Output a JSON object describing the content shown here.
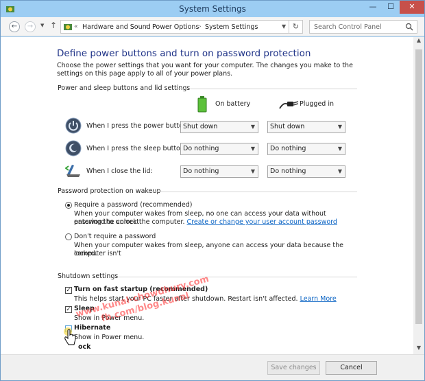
{
  "window": {
    "title": "System Settings",
    "controls": {
      "minimize": "—",
      "maximize": "☐",
      "close": "✕"
    }
  },
  "nav": {
    "back_icon": "arrow-left",
    "forward_icon": "arrow-right",
    "recent_icon": "chevron-down",
    "up_icon": "arrow-up",
    "overflow": "«",
    "breadcrumbs": [
      "Hardware and Sound",
      "Power Options",
      "System Settings"
    ],
    "separator": "›",
    "search_placeholder": "Search Control Panel"
  },
  "heading": "Define power buttons and turn on password protection",
  "intro": "Choose the power settings that you want for your computer. The changes you make to the settings on this page apply to all of your power plans.",
  "power_group": {
    "title": "Power and sleep buttons and lid settings",
    "col_battery": "On battery",
    "col_plugged": "Plugged in",
    "rows": [
      {
        "label": "When I press the power button:",
        "battery": "Shut down",
        "plugged": "Shut down",
        "icon": "power-button-icon"
      },
      {
        "label": "When I press the sleep button:",
        "battery": "Do nothing",
        "plugged": "Do nothing",
        "icon": "sleep-button-icon"
      },
      {
        "label": "When I close the lid:",
        "battery": "Do nothing",
        "plugged": "Do nothing",
        "icon": "laptop-lid-icon"
      }
    ]
  },
  "password_group": {
    "title": "Password protection on wakeup",
    "require_label": "Require a password (recommended)",
    "require_desc_1": "When your computer wakes from sleep, no one can access your data without entering the correct",
    "require_desc_2": "password to unlock the computer.",
    "require_link": "Create or change your user account password",
    "norequire_label": "Don't require a password",
    "norequire_desc_1": "When your computer wakes from sleep, anyone can access your data because the computer isn't",
    "norequire_desc_2": "locked.",
    "selected": "require"
  },
  "shutdown_group": {
    "title": "Shutdown settings",
    "fast_startup_label": "Turn on fast startup (recommended)",
    "fast_startup_desc": "This helps start your PC faster after shutdown. Restart isn't affected.",
    "learn_more": "Learn More",
    "sleep_label": "Sleep",
    "sleep_desc": "Show in Power menu.",
    "hibernate_label": "Hibernate",
    "hibernate_desc": "Show in Power menu.",
    "lock_label": "ock",
    "fast_startup_checked": true,
    "sleep_checked": true,
    "hibernate_checked": false
  },
  "footer": {
    "save": "Save changes",
    "cancel": "Cancel"
  },
  "watermark": {
    "line1": "www.kunal-chowdhury.com",
    "line2": "fb.com/blog.kunal"
  },
  "colors": {
    "titlebar": "#9ccdf3",
    "heading": "#1e3287",
    "link": "#0b64c4",
    "close_button": "#c7504a"
  }
}
